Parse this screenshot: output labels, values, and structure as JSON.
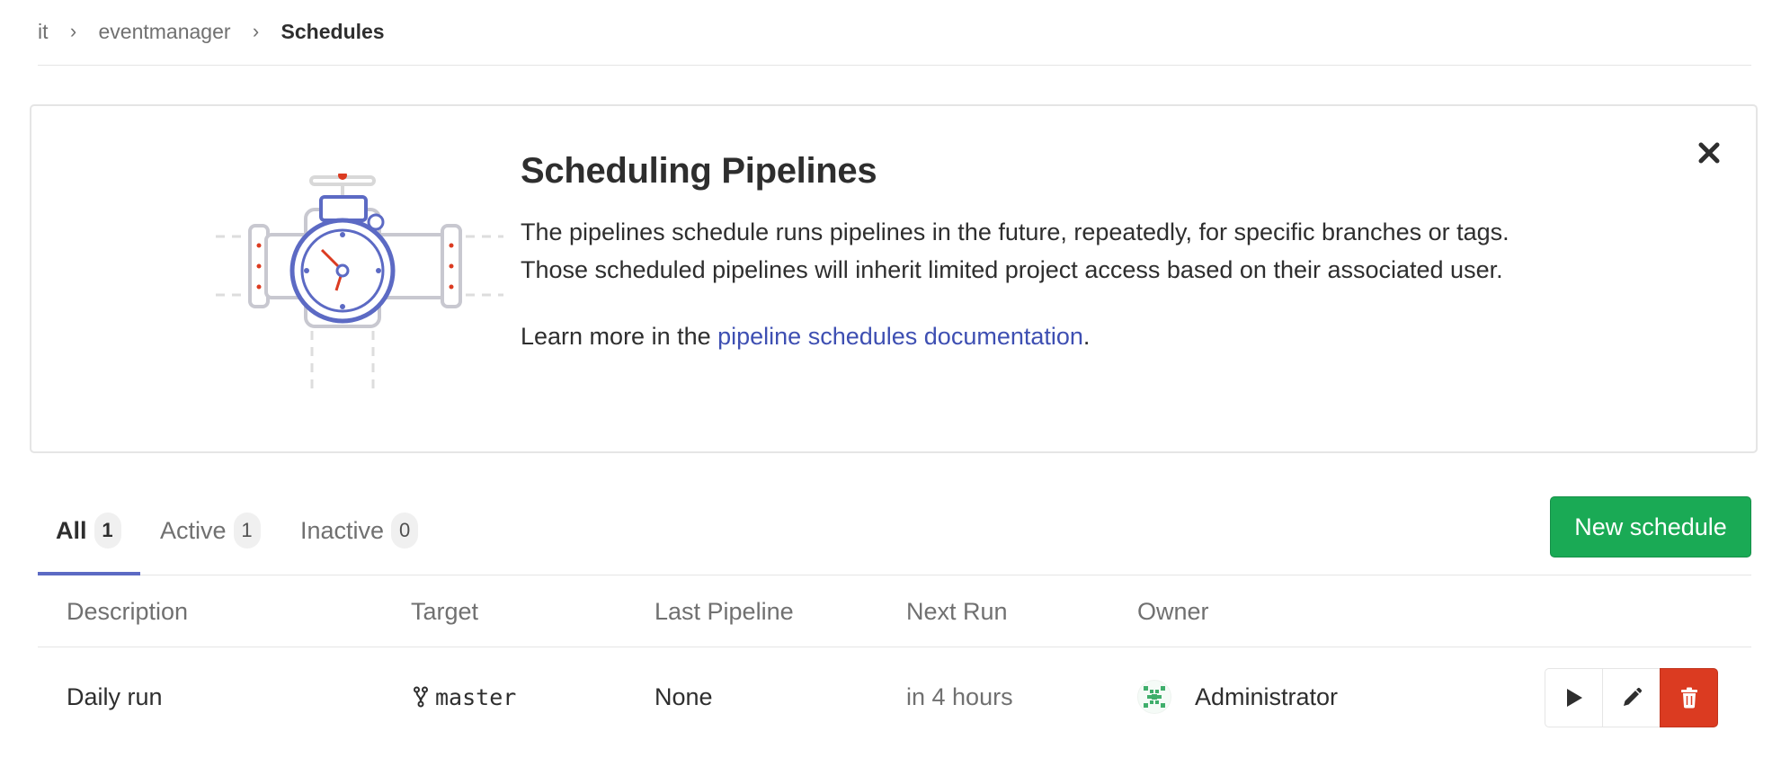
{
  "breadcrumb": {
    "items": [
      "it",
      "eventmanager"
    ],
    "current": "Schedules"
  },
  "callout": {
    "title": "Scheduling Pipelines",
    "body": "The pipelines schedule runs pipelines in the future, repeatedly, for specific branches or tags. Those scheduled pipelines will inherit limited project access based on their associated user.",
    "learn_prefix": "Learn more in the ",
    "learn_link": "pipeline schedules documentation",
    "learn_suffix": ".",
    "close_icon": "close-icon"
  },
  "tabs": [
    {
      "label": "All",
      "count": "1",
      "active": true
    },
    {
      "label": "Active",
      "count": "1",
      "active": false
    },
    {
      "label": "Inactive",
      "count": "0",
      "active": false
    }
  ],
  "new_schedule_label": "New schedule",
  "table": {
    "headers": [
      "Description",
      "Target",
      "Last Pipeline",
      "Next Run",
      "Owner"
    ],
    "rows": [
      {
        "description": "Daily run",
        "target": "master",
        "last_pipeline": "None",
        "next_run": "in 4 hours",
        "owner": "Administrator"
      }
    ]
  },
  "icons": {
    "breadcrumb_separator": "chevron-right-icon",
    "target": "branch-icon",
    "play": "play-icon",
    "edit": "pencil-icon",
    "delete": "trash-icon"
  },
  "colors": {
    "primary_button": "#1aaa55",
    "delete_button": "#db3b21",
    "link": "#3e4fb2",
    "tab_underline": "#5c6ac4"
  }
}
